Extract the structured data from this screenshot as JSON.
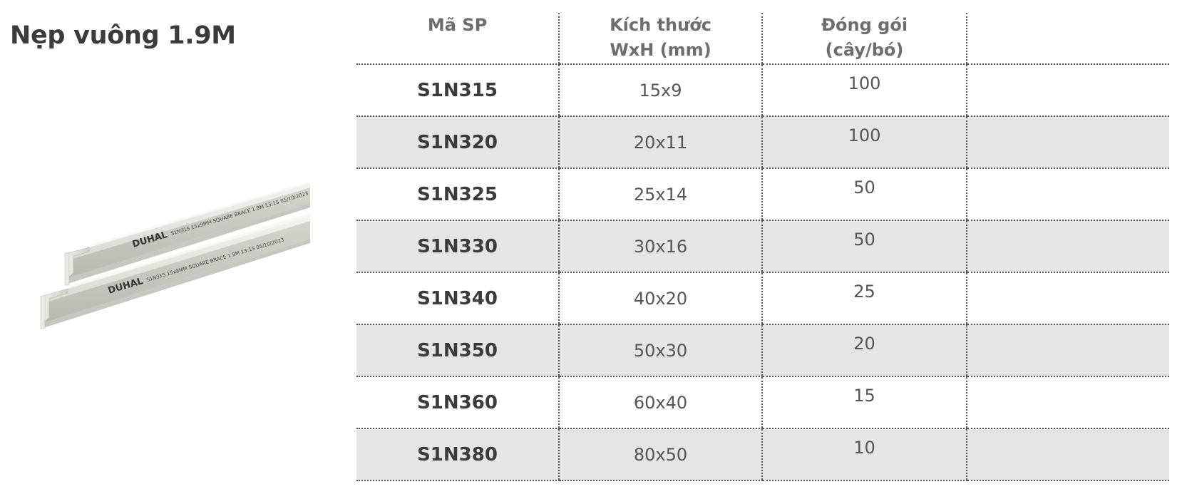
{
  "title": "Nẹp vuông 1.9M",
  "image": {
    "brand": "DUHAL",
    "print_text_1": "S1N315  15x9MM  SQUARE BRACE 1.9M  13:15  05/10/2023",
    "print_text_2": "S1N315  15x9MM  SQUARE BRACE 1.9M  13:15  05/10/2023"
  },
  "table": {
    "headers": [
      {
        "line1": "Mã SP",
        "line2": ""
      },
      {
        "line1": "Kích thước",
        "line2": "WxH (mm)"
      },
      {
        "line1": "Đóng gói",
        "line2": "(cây/bó)"
      },
      {
        "line1": "",
        "line2": ""
      }
    ],
    "rows": [
      {
        "code": "S1N315",
        "size": "15x9",
        "pack": "100",
        "extra": ""
      },
      {
        "code": "S1N320",
        "size": "20x11",
        "pack": "100",
        "extra": ""
      },
      {
        "code": "S1N325",
        "size": "25x14",
        "pack": "50",
        "extra": ""
      },
      {
        "code": "S1N330",
        "size": "30x16",
        "pack": "50",
        "extra": ""
      },
      {
        "code": "S1N340",
        "size": "40x20",
        "pack": "25",
        "extra": ""
      },
      {
        "code": "S1N350",
        "size": "50x30",
        "pack": "20",
        "extra": ""
      },
      {
        "code": "S1N360",
        "size": "60x40",
        "pack": "15",
        "extra": ""
      },
      {
        "code": "S1N380",
        "size": "80x50",
        "pack": "10",
        "extra": ""
      }
    ]
  },
  "colors": {
    "row_shade": "#e5e5e5",
    "text_dark": "#3b3b3b",
    "header_text": "#6d6d6d"
  }
}
